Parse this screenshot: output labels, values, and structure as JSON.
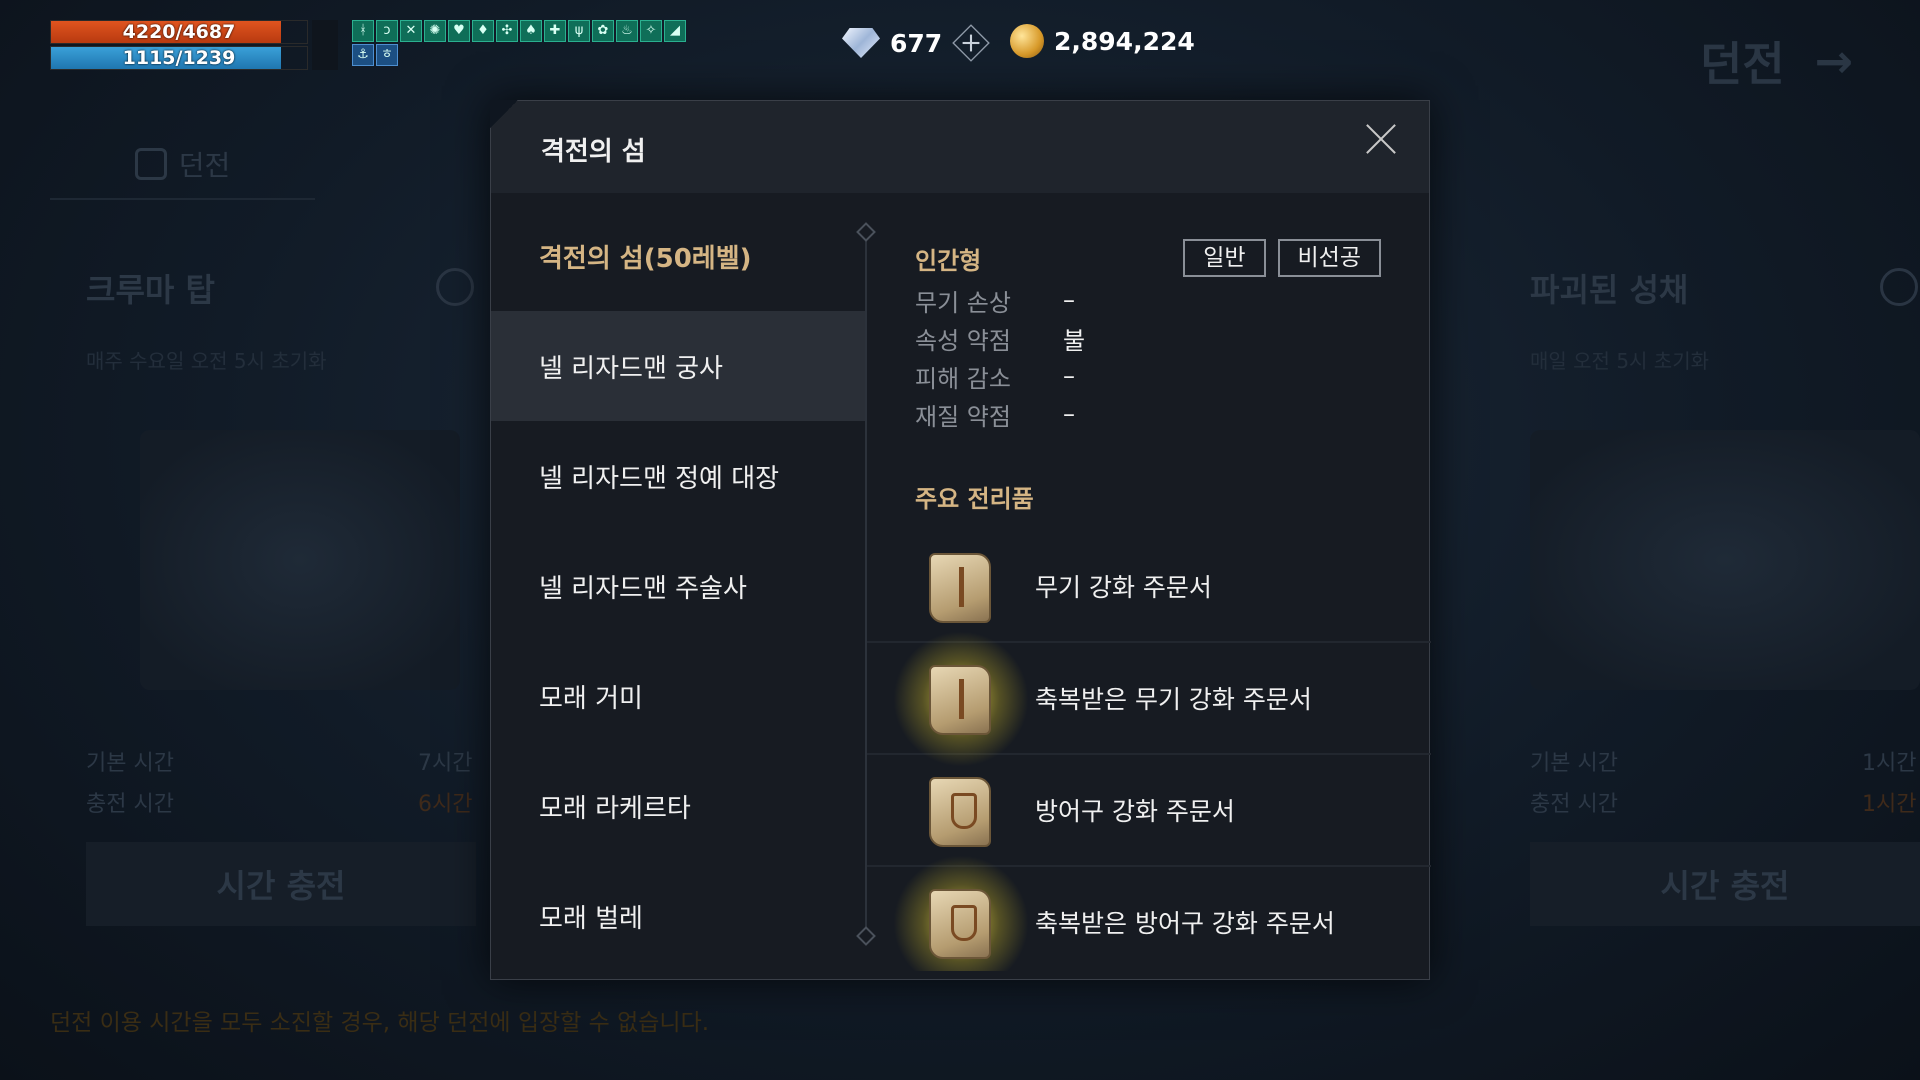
{
  "hud": {
    "hp_text": "4220/4687",
    "hp_fraction": 0.9,
    "mp_text": "1115/1239",
    "mp_fraction": 0.9,
    "buffs_row1": [
      "ᚼ",
      "ɔ",
      "✕",
      "✺",
      "♥",
      "♦",
      "✣",
      "♠",
      "✚",
      "ψ",
      "✿",
      "♨",
      "✧",
      "◢"
    ],
    "buffs_row2": [
      "⚓",
      "ㅎ"
    ]
  },
  "currency": {
    "gems": "677",
    "gold": "2,894,224"
  },
  "top_right": {
    "title": "던전"
  },
  "background": {
    "tab_label": "던전",
    "card_left_title": "크루마 탑",
    "card_left_sub": "매주 수요일 오전 5시 초기화",
    "card_right_title": "파괴된 성채",
    "card_right_sub": "매일 오전 5시 초기화",
    "base_time_label": "기본 시간",
    "charge_time_label": "충전 시간",
    "left_base_time": "7시간",
    "left_charge_time": "6시간",
    "right_base_time": "1시간",
    "right_charge_time": "1시간",
    "charge_button": "시간 충전",
    "notice": "던전 이용 시간을 모두 소진할 경우, 해당 던전에 입장할 수 없습니다."
  },
  "modal": {
    "title": "격전의 섬",
    "list_header": "격전의 섬(50레벨)",
    "mobs": [
      "넬 리자드맨 궁사",
      "넬 리자드맨 정예 대장",
      "넬 리자드맨 주술사",
      "모래 거미",
      "모래 라케르타",
      "모래 벌레"
    ],
    "selected_index": 0,
    "detail": {
      "race": "인간형",
      "difficulty_buttons": [
        "일반",
        "비선공"
      ],
      "stats": [
        {
          "label": "무기 손상",
          "value": "–"
        },
        {
          "label": "속성 약점",
          "value": "불"
        },
        {
          "label": "피해 감소",
          "value": "–"
        },
        {
          "label": "재질 약점",
          "value": "–"
        }
      ],
      "drops_title": "주요 전리품",
      "drops": [
        {
          "name": "무기 강화 주문서",
          "icon": "weapon-scroll-icon",
          "blessed": false
        },
        {
          "name": "축복받은 무기 강화 주문서",
          "icon": "blessed-weapon-scroll-icon",
          "blessed": true
        },
        {
          "name": "방어구 강화 주문서",
          "icon": "armor-scroll-icon",
          "blessed": false
        },
        {
          "name": "축복받은 방어구 강화 주문서",
          "icon": "blessed-armor-scroll-icon",
          "blessed": true
        }
      ]
    }
  }
}
